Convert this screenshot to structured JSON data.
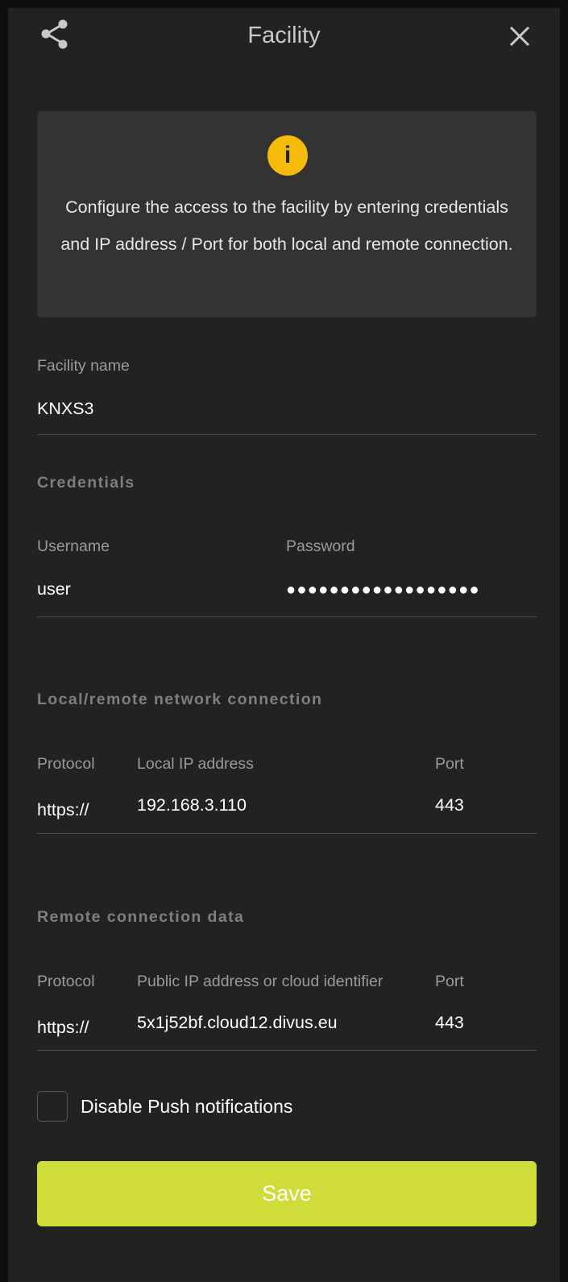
{
  "header": {
    "title": "Facility",
    "share_icon": "share-icon",
    "close_icon": "close-icon"
  },
  "info": {
    "icon": "info-icon",
    "icon_glyph": "i",
    "icon_color": "#f5ba0a",
    "text": "Configure the access to the facility by entering credentials and IP address / Port for both local and remote connection."
  },
  "facility": {
    "label": "Facility name",
    "value": "KNXS3"
  },
  "credentials": {
    "section_title": "Credentials",
    "username_label": "Username",
    "username_value": "user",
    "password_label": "Password",
    "password_value": "●●●●●●●●●●●●●●●●●●"
  },
  "local": {
    "section_title": "Local/remote network connection",
    "protocol_label": "Protocol",
    "protocol_value": "https://",
    "address_label": "Local IP address",
    "address_value": "192.168.3.110",
    "port_label": "Port",
    "port_value": "443"
  },
  "remote": {
    "section_title": "Remote connection data",
    "protocol_label": "Protocol",
    "protocol_value": "https://",
    "address_label": "Public IP address or cloud identifier",
    "address_value": "5x1j52bf.cloud12.divus.eu",
    "port_label": "Port",
    "port_value": "443"
  },
  "push": {
    "label": "Disable Push notifications",
    "checked": false
  },
  "save": {
    "label": "Save",
    "color": "#cfdc3a"
  }
}
